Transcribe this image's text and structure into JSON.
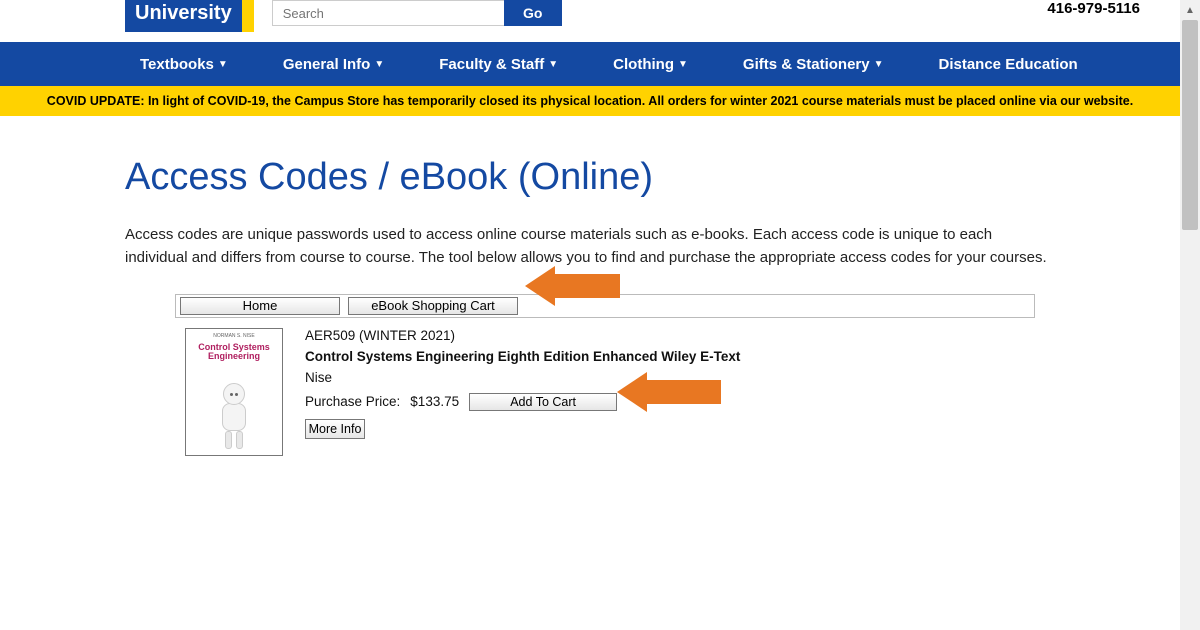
{
  "header": {
    "logo_text": "University",
    "search_placeholder": "Search",
    "go_label": "Go",
    "phone": "416-979-5116"
  },
  "nav": {
    "items": [
      {
        "label": "Textbooks",
        "dropdown": true
      },
      {
        "label": "General Info",
        "dropdown": true
      },
      {
        "label": "Faculty & Staff",
        "dropdown": true
      },
      {
        "label": "Clothing",
        "dropdown": true
      },
      {
        "label": "Gifts & Stationery",
        "dropdown": true
      },
      {
        "label": "Distance Education",
        "dropdown": false
      }
    ]
  },
  "covid_banner": "COVID UPDATE: In light of COVID-19, the Campus Store has temporarily closed its physical location. All orders for winter 2021 course materials must be placed online via our website.",
  "page": {
    "title": "Access Codes / eBook (Online)",
    "intro": "Access codes are unique passwords used to access online course materials such as e-books. Each access code is unique to each individual and differs from course to course. The tool below allows you to find and purchase the appropriate access codes for your courses."
  },
  "tool": {
    "home_label": "Home",
    "cart_label": "eBook Shopping Cart"
  },
  "product": {
    "cover_title_line1": "Control Systems",
    "cover_title_line2": "Engineering",
    "course": "AER509 (WINTER 2021)",
    "title": "Control Systems Engineering Eighth Edition Enhanced Wiley E-Text",
    "author": "Nise",
    "price_label": "Purchase Price:",
    "price": "$133.75",
    "add_label": "Add To Cart",
    "more_label": "More Info"
  }
}
